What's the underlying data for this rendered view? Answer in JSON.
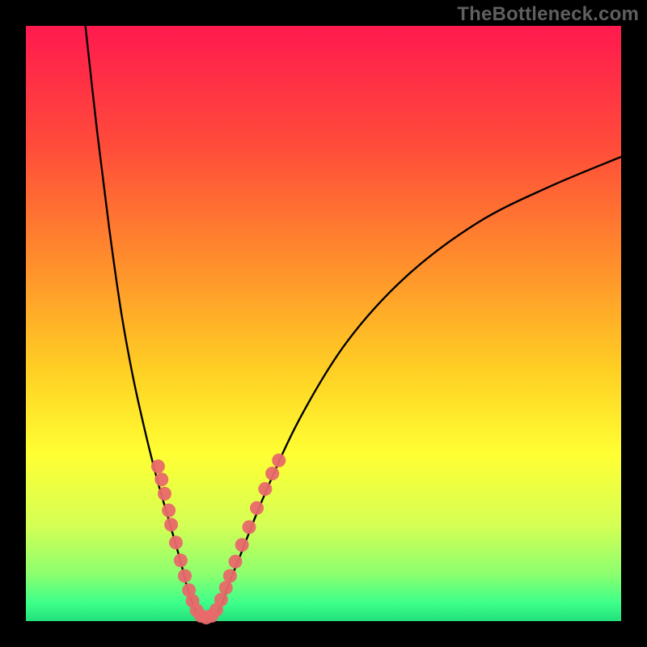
{
  "watermark": "TheBottleneck.com",
  "colors": {
    "black": "#000000",
    "curve": "#000000",
    "marker_fill": "#e8696a",
    "marker_stroke": "#c94a4c",
    "gradient_stops": [
      {
        "offset": 0.0,
        "color": "#ff1a4f"
      },
      {
        "offset": 0.2,
        "color": "#ff4b3a"
      },
      {
        "offset": 0.4,
        "color": "#ff8f2c"
      },
      {
        "offset": 0.58,
        "color": "#ffd024"
      },
      {
        "offset": 0.72,
        "color": "#ffff33"
      },
      {
        "offset": 0.84,
        "color": "#d4ff55"
      },
      {
        "offset": 0.92,
        "color": "#8dff6e"
      },
      {
        "offset": 0.97,
        "color": "#3cff8a"
      },
      {
        "offset": 1.0,
        "color": "#23e07b"
      }
    ]
  },
  "chart_data": {
    "type": "line",
    "title": "",
    "xlabel": "",
    "ylabel": "",
    "xlim": [
      0,
      100
    ],
    "ylim": [
      0,
      100
    ],
    "grid": false,
    "series": [
      {
        "name": "bottleneck-curve",
        "x": [
          10,
          12,
          14,
          16,
          18,
          20,
          22,
          24,
          26,
          27,
          28,
          29,
          30,
          31,
          32,
          33,
          34,
          36,
          40,
          46,
          54,
          64,
          76,
          88,
          100
        ],
        "y": [
          100,
          82,
          66,
          52,
          41,
          32,
          24,
          17,
          10,
          6,
          3,
          1.2,
          0.6,
          0.6,
          1.2,
          3,
          6,
          11,
          21,
          34,
          47,
          58,
          67,
          73,
          78
        ]
      }
    ],
    "markers": [
      {
        "x": 22.2,
        "y": 26.0
      },
      {
        "x": 22.8,
        "y": 23.8
      },
      {
        "x": 23.3,
        "y": 21.4
      },
      {
        "x": 24.0,
        "y": 18.6
      },
      {
        "x": 24.4,
        "y": 16.2
      },
      {
        "x": 25.2,
        "y": 13.2
      },
      {
        "x": 26.0,
        "y": 10.2
      },
      {
        "x": 26.7,
        "y": 7.6
      },
      {
        "x": 27.4,
        "y": 5.2
      },
      {
        "x": 28.0,
        "y": 3.4
      },
      {
        "x": 28.7,
        "y": 1.8
      },
      {
        "x": 29.4,
        "y": 0.9
      },
      {
        "x": 30.3,
        "y": 0.6
      },
      {
        "x": 31.2,
        "y": 0.9
      },
      {
        "x": 32.0,
        "y": 1.9
      },
      {
        "x": 32.8,
        "y": 3.6
      },
      {
        "x": 33.6,
        "y": 5.6
      },
      {
        "x": 34.3,
        "y": 7.6
      },
      {
        "x": 35.2,
        "y": 10.0
      },
      {
        "x": 36.3,
        "y": 12.8
      },
      {
        "x": 37.5,
        "y": 15.8
      },
      {
        "x": 38.8,
        "y": 19.0
      },
      {
        "x": 40.2,
        "y": 22.2
      },
      {
        "x": 41.4,
        "y": 24.8
      },
      {
        "x": 42.5,
        "y": 27.0
      }
    ]
  }
}
